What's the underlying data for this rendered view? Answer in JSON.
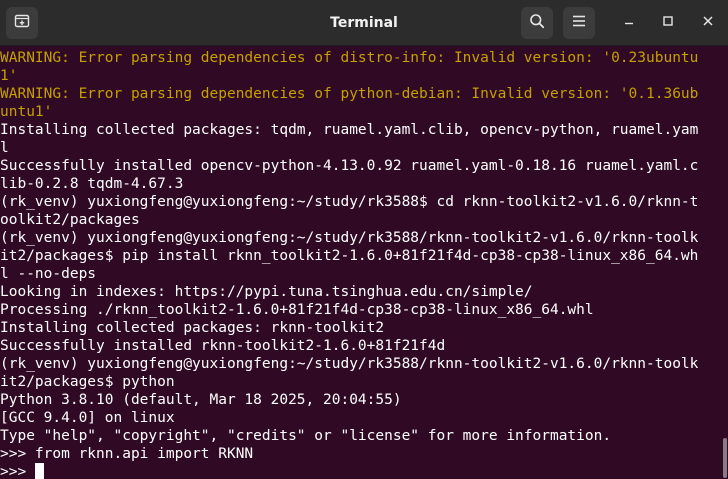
{
  "window": {
    "title": "Terminal",
    "icons": {
      "new_tab": "new-tab-icon",
      "search": "search-icon",
      "menu": "hamburger-menu-icon",
      "minimize": "minimize-icon",
      "maximize": "maximize-icon",
      "close": "close-icon"
    }
  },
  "colors": {
    "background": "#300a24",
    "text": "#ffffff",
    "warning": "#c4a000",
    "titlebar": "#2c2c2c"
  },
  "terminal": {
    "lines": [
      {
        "text": "WARNING: Error parsing dependencies of distro-info: Invalid version: '0.23ubuntu",
        "kind": "warning"
      },
      {
        "text": "1'",
        "kind": "warning"
      },
      {
        "text": "WARNING: Error parsing dependencies of python-debian: Invalid version: '0.1.36ub",
        "kind": "warning"
      },
      {
        "text": "untu1'",
        "kind": "warning"
      },
      {
        "text": "Installing collected packages: tqdm, ruamel.yaml.clib, opencv-python, ruamel.yam",
        "kind": "normal"
      },
      {
        "text": "l",
        "kind": "normal"
      },
      {
        "text": "Successfully installed opencv-python-4.13.0.92 ruamel.yaml-0.18.16 ruamel.yaml.c",
        "kind": "normal"
      },
      {
        "text": "lib-0.2.8 tqdm-4.67.3",
        "kind": "normal"
      },
      {
        "text": "(rk_venv) yuxiongfeng@yuxiongfeng:~/study/rk3588$ cd rknn-toolkit2-v1.6.0/rknn-t",
        "kind": "normal"
      },
      {
        "text": "oolkit2/packages",
        "kind": "normal"
      },
      {
        "text": "(rk_venv) yuxiongfeng@yuxiongfeng:~/study/rk3588/rknn-toolkit2-v1.6.0/rknn-toolk",
        "kind": "normal"
      },
      {
        "text": "it2/packages$ pip install rknn_toolkit2-1.6.0+81f21f4d-cp38-cp38-linux_x86_64.wh",
        "kind": "normal"
      },
      {
        "text": "l --no-deps",
        "kind": "normal"
      },
      {
        "text": "Looking in indexes: https://pypi.tuna.tsinghua.edu.cn/simple/",
        "kind": "normal"
      },
      {
        "text": "Processing ./rknn_toolkit2-1.6.0+81f21f4d-cp38-cp38-linux_x86_64.whl",
        "kind": "normal"
      },
      {
        "text": "Installing collected packages: rknn-toolkit2",
        "kind": "normal"
      },
      {
        "text": "Successfully installed rknn-toolkit2-1.6.0+81f21f4d",
        "kind": "normal"
      },
      {
        "text": "(rk_venv) yuxiongfeng@yuxiongfeng:~/study/rk3588/rknn-toolkit2-v1.6.0/rknn-toolk",
        "kind": "normal"
      },
      {
        "text": "it2/packages$ python",
        "kind": "normal"
      },
      {
        "text": "Python 3.8.10 (default, Mar 18 2025, 20:04:55)",
        "kind": "normal"
      },
      {
        "text": "[GCC 9.4.0] on linux",
        "kind": "normal"
      },
      {
        "text": "Type \"help\", \"copyright\", \"credits\" or \"license\" for more information.",
        "kind": "normal"
      },
      {
        "text": ">>> from rknn.api import RKNN",
        "kind": "normal"
      }
    ],
    "prompt_line": ">>> "
  }
}
